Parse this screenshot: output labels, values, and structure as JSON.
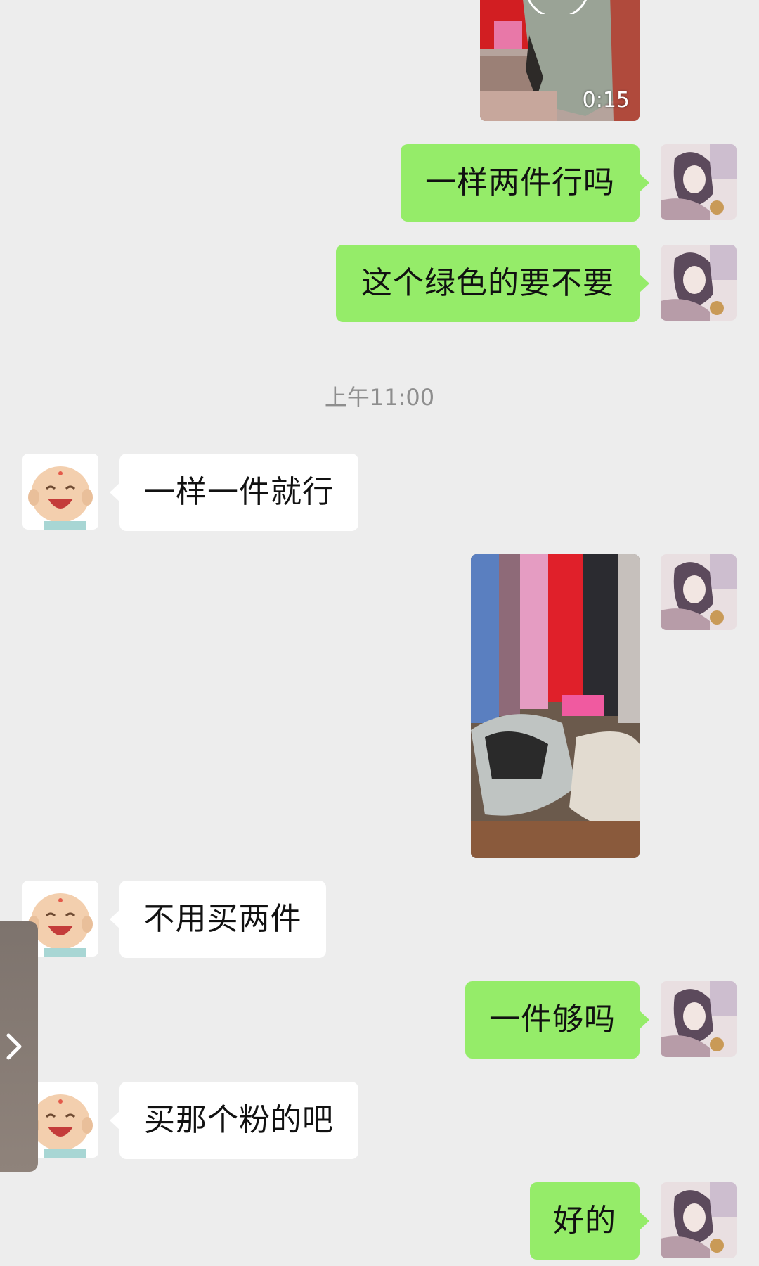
{
  "video": {
    "duration": "0:15"
  },
  "messages": [
    {
      "side": "out",
      "text": "一样两件行吗"
    },
    {
      "side": "out",
      "text": "这个绿色的要不要"
    },
    {
      "side": "in",
      "text": "一样一件就行"
    },
    {
      "side": "out",
      "type": "image"
    },
    {
      "side": "in",
      "text": "不用买两件"
    },
    {
      "side": "out",
      "text": "一件够吗"
    },
    {
      "side": "in",
      "text": "买那个粉的吧"
    },
    {
      "side": "out",
      "text": "好的"
    }
  ],
  "timestamp": "上午11:00",
  "icons": {
    "side_tab": "chevron-right-icon"
  },
  "colors": {
    "background": "#ededed",
    "outgoing_bubble": "#95ec69",
    "incoming_bubble": "#ffffff",
    "timestamp": "#8e8e8e"
  }
}
